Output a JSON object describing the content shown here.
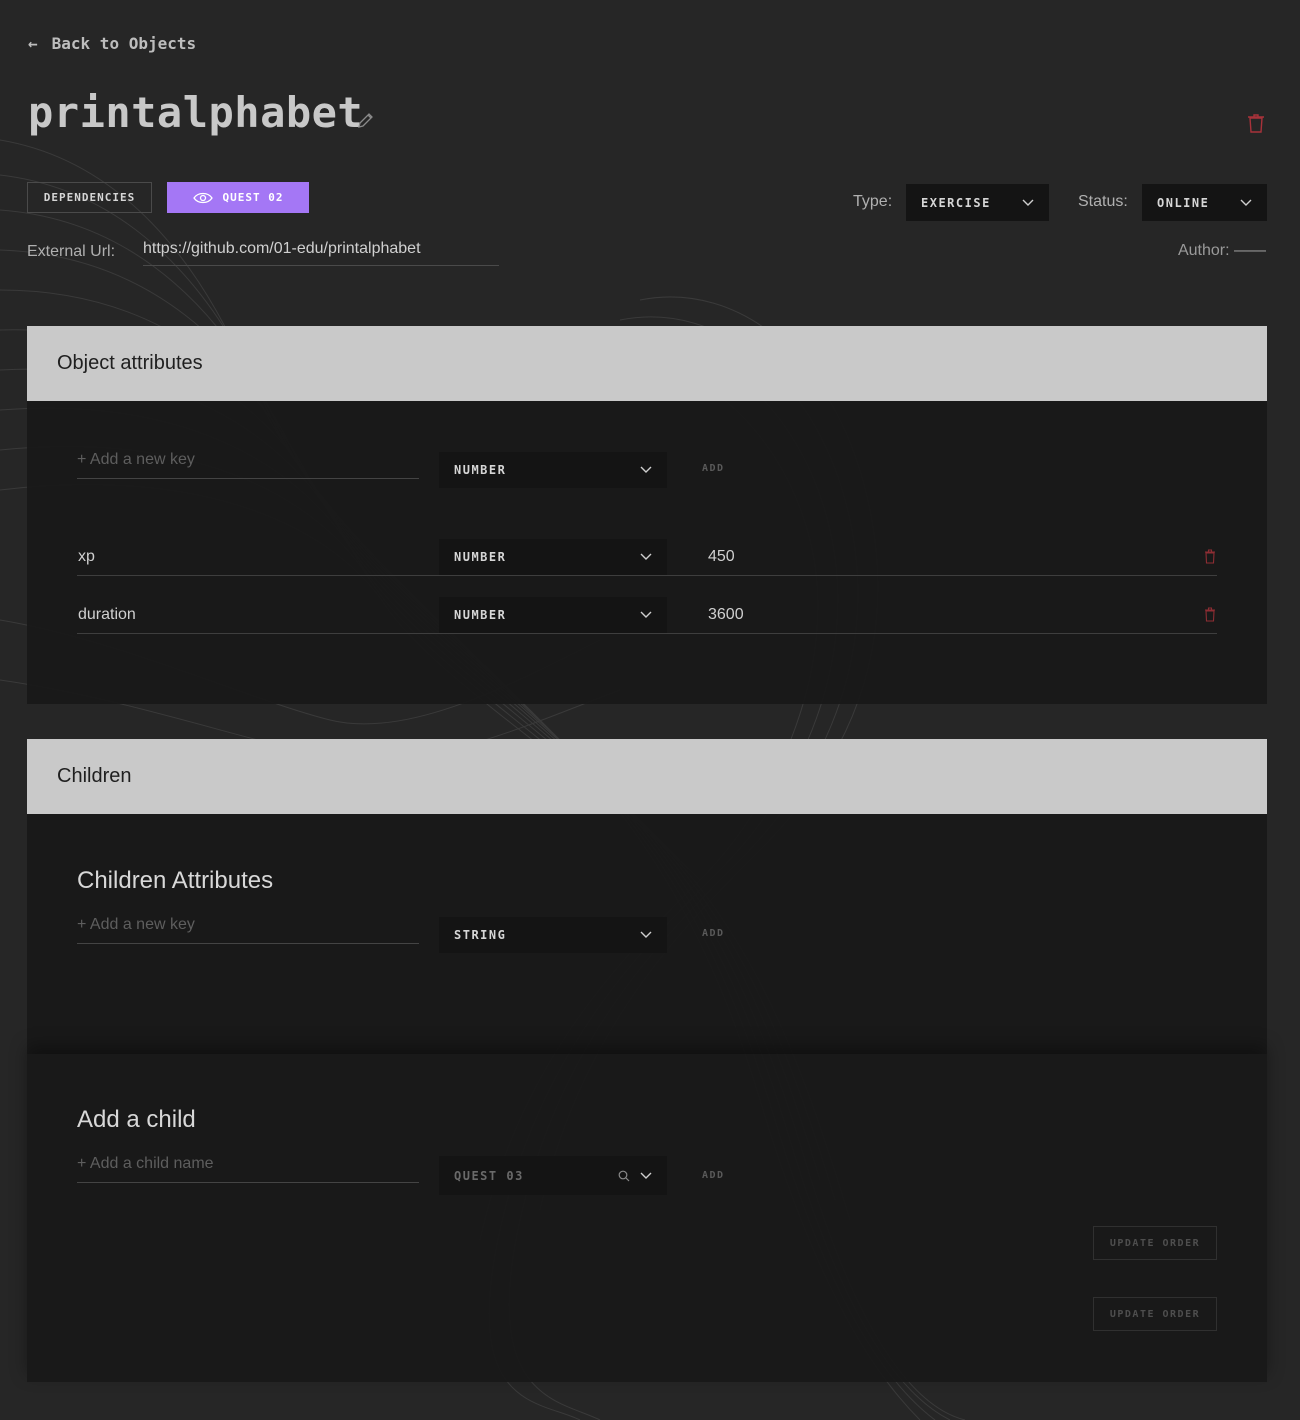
{
  "header": {
    "back_label": "Back to Objects",
    "title": "printalphabet",
    "dependencies_label": "DEPENDENCIES",
    "quest_label": "QUEST 02",
    "type_label": "Type:",
    "type_value": "EXERCISE",
    "status_label": "Status:",
    "status_value": "ONLINE",
    "external_url_label": "External Url:",
    "external_url_value": "https://github.com/01-edu/printalphabet",
    "author_label": "Author:",
    "author_value": "——"
  },
  "object_attributes": {
    "title": "Object attributes",
    "new_key_placeholder": "+ Add a new key",
    "new_key_type": "NUMBER",
    "add_label": "ADD",
    "rows": [
      {
        "key": "xp",
        "type": "NUMBER",
        "value": "450"
      },
      {
        "key": "duration",
        "type": "NUMBER",
        "value": "3600"
      }
    ]
  },
  "children": {
    "title": "Children",
    "attributes_title": "Children Attributes",
    "new_key_placeholder": "+ Add a new key",
    "new_key_type": "STRING",
    "add_label": "ADD",
    "add_child_title": "Add a child",
    "child_name_placeholder": "+ Add a child name",
    "child_select_value": "QUEST 03",
    "child_add_label": "ADD",
    "update_order_label_1": "UPDATE ORDER",
    "update_order_label_2": "UPDATE ORDER"
  },
  "colors": {
    "accent": "#a477f5",
    "danger": "#a8323a",
    "background": "#262626",
    "panel_header": "#c9c9c9"
  },
  "icons": [
    "arrow-left-icon",
    "pencil-icon",
    "trash-icon",
    "eye-icon",
    "chevron-down-icon",
    "search-icon"
  ]
}
